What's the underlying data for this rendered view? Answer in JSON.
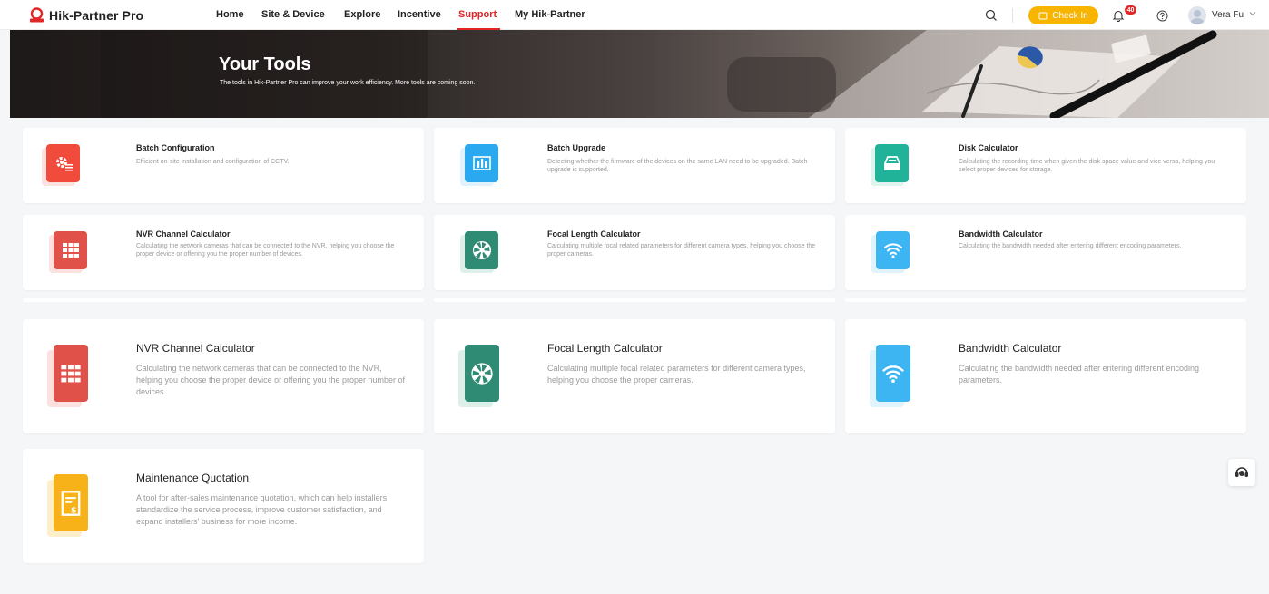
{
  "brand": {
    "name": "Hik-Partner Pro",
    "color": "#e02626"
  },
  "nav": [
    {
      "label": "Home"
    },
    {
      "label": "Site & Device"
    },
    {
      "label": "Explore"
    },
    {
      "label": "Incentive"
    },
    {
      "label": "Support",
      "active": true
    },
    {
      "label": "My Hik-Partner"
    }
  ],
  "topbar": {
    "search_icon": "search-icon",
    "checkin_label": "Check In",
    "checkin_color": "#f7b500",
    "notification_count": "40",
    "help_icon": "help-icon",
    "user_name": "Vera Fu"
  },
  "banner": {
    "title": "Your Tools",
    "subtitle": "The tools in Hik-Partner Pro can improve your work efficiency. More tools are coming soon."
  },
  "tools_small": [
    {
      "title": "Batch Configuration",
      "desc": "Efficient on-site installation and configuration of CCTV.",
      "color": "#f04b3b",
      "icon": "gear-list-icon"
    },
    {
      "title": "Batch Upgrade",
      "desc": "Detecting whether the firmware of the devices on the same LAN need to be upgraded. Batch upgrade is supported.",
      "color": "#2aa9f0",
      "icon": "upgrade-icon"
    },
    {
      "title": "Disk Calculator",
      "desc": "Calculating the recording time when given the disk space value and vice versa, helping you select proper devices for storage.",
      "color": "#20b39a",
      "icon": "disk-icon"
    },
    {
      "title": "NVR Channel Calculator",
      "desc": "Calculating the network cameras that can be connected to the NVR, helping you choose the proper device or offering you the proper number of devices.",
      "color": "#e05149",
      "icon": "grid-icon"
    },
    {
      "title": "Focal Length Calculator",
      "desc": "Calculating multiple focal related parameters for different camera types, helping you choose the proper cameras.",
      "color": "#2f8b73",
      "icon": "aperture-icon"
    },
    {
      "title": "Bandwidth Calculator",
      "desc": "Calculating the bandwidth needed after entering different encoding parameters.",
      "color": "#3db5f2",
      "icon": "wifi-icon"
    }
  ],
  "tools_large": [
    {
      "title": "NVR Channel Calculator",
      "desc": "Calculating the network cameras that can be connected to the NVR, helping you choose the proper device or offering you the proper number of devices.",
      "color": "#e05149",
      "icon": "grid-icon"
    },
    {
      "title": "Focal Length Calculator",
      "desc": "Calculating multiple focal related parameters for different camera types, helping you choose the proper cameras.",
      "color": "#2f8b73",
      "icon": "aperture-icon"
    },
    {
      "title": "Bandwidth Calculator",
      "desc": "Calculating the bandwidth needed after entering different encoding parameters.",
      "color": "#3db5f2",
      "icon": "wifi-icon"
    },
    {
      "title": "Maintenance Quotation",
      "desc": "A tool for after-sales maintenance quotation, which can help installers standardize the service process, improve customer satisfaction, and expand installers' business for more income.",
      "color": "#f7b21a",
      "icon": "quotation-icon"
    }
  ],
  "support_icon": "headset-icon"
}
